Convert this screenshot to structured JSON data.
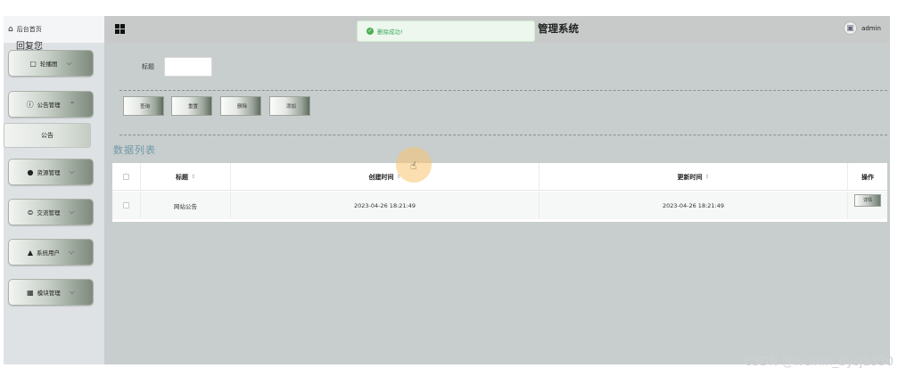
{
  "sidebar": {
    "home_icon": "home-icon",
    "home_label": "后台首页",
    "scribble": "回复您",
    "items": [
      {
        "label": "轮播图",
        "icon": "image-icon",
        "icon_glyph": "▢",
        "chevron": "⌵"
      },
      {
        "label": "公告管理",
        "icon": "info-circle-icon",
        "icon_glyph": "ⓘ",
        "chevron": "⌃"
      },
      {
        "label": "资源管理",
        "icon": "pin-icon",
        "icon_glyph": "●",
        "chevron": "⌵"
      },
      {
        "label": "交流管理",
        "icon": "chat-icon",
        "icon_glyph": "⊜",
        "chevron": "⌵"
      },
      {
        "label": "系统用户",
        "icon": "user-icon",
        "icon_glyph": "▲",
        "chevron": "⌵"
      },
      {
        "label": "模块管理",
        "icon": "grid-icon",
        "icon_glyph": "▦",
        "chevron": "⌵"
      }
    ],
    "active_sub": "公告"
  },
  "header": {
    "menu_icon": "grid-menu-icon",
    "title": "管理系统",
    "username": "admin",
    "avatar_icon": "image-icon"
  },
  "toast": {
    "message": "删除成功!",
    "icon": "check-circle-icon",
    "color": "#3aa85a"
  },
  "search": {
    "label": "标题",
    "value": "",
    "placeholder": ""
  },
  "actions": {
    "query": "查询",
    "reset": "重置",
    "delete": "删除",
    "add": "添加"
  },
  "section_title": "数据列表",
  "table": {
    "columns": {
      "title": "标题",
      "created": "创建时间",
      "updated": "更新时间",
      "operation": "操作"
    },
    "sort_icon": "⇕",
    "rows": [
      {
        "title": "网站公告",
        "created": "2023-04-26 18:21:49",
        "updated": "2023-04-26 18:21:49",
        "action": "详情"
      }
    ]
  },
  "watermark": "CSDN @weixin_bysj1330",
  "colors": {
    "header_bg": "#c7cac9",
    "main_bg": "#c8cdce",
    "sidebar_bg": "#dfe2e5",
    "section_title": "#6f9aa8"
  }
}
